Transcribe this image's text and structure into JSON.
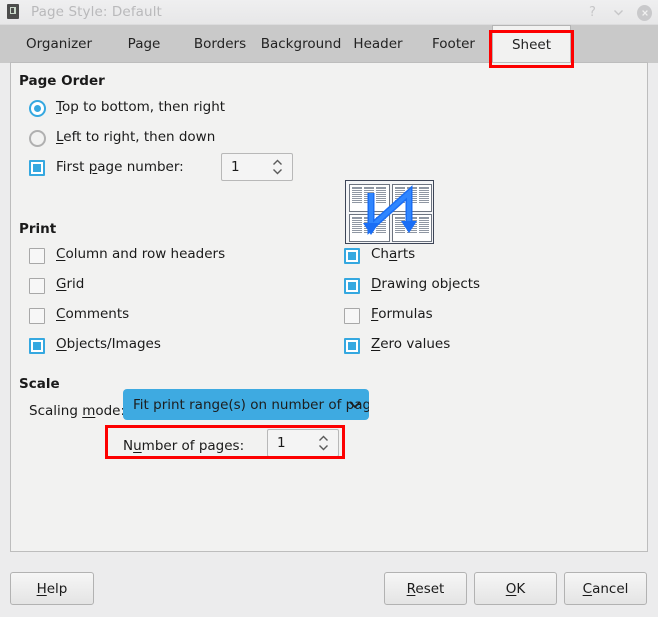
{
  "window": {
    "title": "Page Style: Default",
    "icon": "document-icon",
    "controls": [
      {
        "name": "help-button",
        "glyph": "?"
      },
      {
        "name": "minimize-button",
        "glyph": "chevron-down-icon"
      },
      {
        "name": "close-button",
        "glyph": "×"
      }
    ]
  },
  "tabs": [
    {
      "label": "Organizer",
      "active": false
    },
    {
      "label": "Page",
      "active": false
    },
    {
      "label": "Borders",
      "active": false
    },
    {
      "label": "Background",
      "active": false
    },
    {
      "label": "Header",
      "active": false
    },
    {
      "label": "Footer",
      "active": false
    },
    {
      "label": "Sheet",
      "active": true
    }
  ],
  "page_order": {
    "title": "Page Order",
    "options": [
      {
        "label": "Top to bottom, then right",
        "mnemonic": "T",
        "selected": true
      },
      {
        "label": "Left to right, then down",
        "mnemonic": "L",
        "selected": false
      }
    ],
    "first_page_number": {
      "label": "First page number:",
      "mnemonic": "p",
      "checked": true,
      "value": "1"
    },
    "preview_alt": "page-order-preview"
  },
  "print": {
    "title": "Print",
    "left_column": [
      {
        "label": "Column and row headers",
        "mnemonic": "C",
        "checked": false
      },
      {
        "label": "Grid",
        "mnemonic": "G",
        "checked": false
      },
      {
        "label": "Comments",
        "mnemonic": "C",
        "checked": false
      },
      {
        "label": "Objects/Images",
        "mnemonic": "O",
        "checked": true
      }
    ],
    "right_column": [
      {
        "label": "Charts",
        "mnemonic": "a",
        "checked": true
      },
      {
        "label": "Drawing objects",
        "mnemonic": "D",
        "checked": true
      },
      {
        "label": "Formulas",
        "mnemonic": "F",
        "checked": false
      },
      {
        "label": "Zero values",
        "mnemonic": "Z",
        "checked": true
      }
    ]
  },
  "scale": {
    "title": "Scale",
    "scaling_mode_label": "Scaling mode:",
    "scaling_mode_mnemonic": "m",
    "scaling_mode_value": "Fit print range(s) on number of pages",
    "number_of_pages_label": "Number of pages:",
    "number_of_pages_mnemonic": "u",
    "number_of_pages_value": "1"
  },
  "buttons": [
    {
      "name": "help-button",
      "label": "Help",
      "mnemonic": "H"
    },
    {
      "name": "reset-button",
      "label": "Reset",
      "mnemonic": "R"
    },
    {
      "name": "ok-button",
      "label": "OK",
      "mnemonic": "O"
    },
    {
      "name": "cancel-button",
      "label": "Cancel",
      "mnemonic": "C"
    }
  ],
  "colors": {
    "accent": "#35a8e0",
    "dropdown_selected": "#3eaae1",
    "annotation": "#fd0000",
    "panel_bg": "#f2f2f1",
    "tabbar_bg": "#c9c9c9"
  }
}
